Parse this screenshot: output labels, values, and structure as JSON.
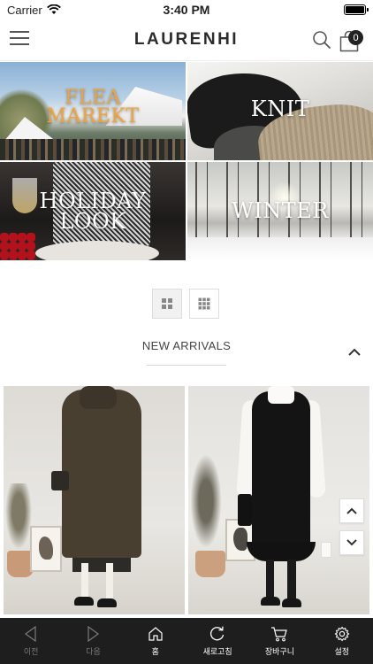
{
  "status_bar": {
    "carrier": "Carrier",
    "time": "3:40 PM",
    "battery_level": 1.0
  },
  "header": {
    "brand": "LAURENHI",
    "cart_count": "0",
    "icons": {
      "menu": "hamburger-menu-icon",
      "search": "search-icon",
      "cart": "shopping-bag-icon"
    }
  },
  "categories": [
    {
      "label_line1": "FLEA",
      "label_line2": "MAREKT",
      "label_color": "#f0a33a"
    },
    {
      "label_line1": "KNIT",
      "label_line2": ""
    },
    {
      "label_line1": "HOLIDAY",
      "label_line2": "LOOK"
    },
    {
      "label_line1": "WINTER",
      "label_line2": ""
    }
  ],
  "view_toggle": {
    "options": [
      "grid-2-icon",
      "grid-3-icon"
    ],
    "active": 0
  },
  "section": {
    "title": "NEW ARRIVALS",
    "collapse_icon": "chevron-up-icon"
  },
  "products": [
    {
      "image": "olive-wool-coat-photo"
    },
    {
      "image": "black-pinafore-dress-photo"
    }
  ],
  "scroll_buttons": {
    "up_icon": "chevron-up-icon",
    "down_icon": "chevron-down-icon"
  },
  "tab_bar": {
    "items": [
      {
        "label": "이전",
        "icon": "back-triangle-icon",
        "enabled": false
      },
      {
        "label": "다음",
        "icon": "forward-triangle-icon",
        "enabled": false
      },
      {
        "label": "홈",
        "icon": "home-icon",
        "enabled": true
      },
      {
        "label": "새로고침",
        "icon": "refresh-icon",
        "enabled": true
      },
      {
        "label": "장바구니",
        "icon": "cart-icon",
        "enabled": true
      },
      {
        "label": "설정",
        "icon": "gear-icon",
        "enabled": true
      }
    ]
  },
  "colors": {
    "accent_flea": "#f0a33a",
    "tab_bar_bg": "#1e1e1e",
    "brand_text": "#2b2b2b"
  }
}
